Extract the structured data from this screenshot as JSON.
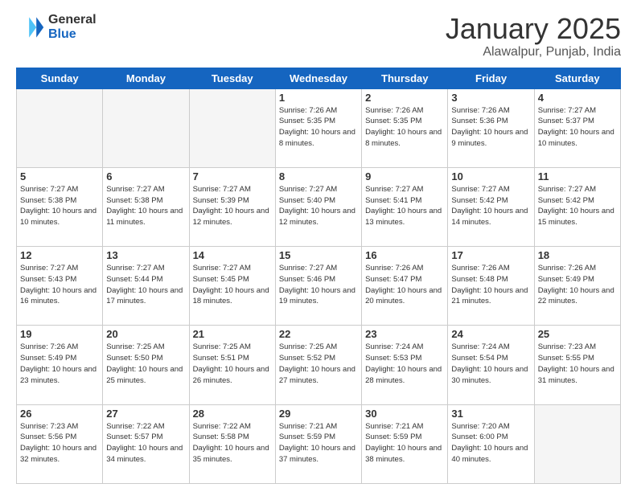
{
  "logo": {
    "line1": "General",
    "line2": "Blue"
  },
  "header": {
    "title": "January 2025",
    "subtitle": "Alawalpur, Punjab, India"
  },
  "weekdays": [
    "Sunday",
    "Monday",
    "Tuesday",
    "Wednesday",
    "Thursday",
    "Friday",
    "Saturday"
  ],
  "weeks": [
    [
      {
        "day": "",
        "detail": ""
      },
      {
        "day": "",
        "detail": ""
      },
      {
        "day": "",
        "detail": ""
      },
      {
        "day": "1",
        "detail": "Sunrise: 7:26 AM\nSunset: 5:35 PM\nDaylight: 10 hours\nand 8 minutes."
      },
      {
        "day": "2",
        "detail": "Sunrise: 7:26 AM\nSunset: 5:35 PM\nDaylight: 10 hours\nand 8 minutes."
      },
      {
        "day": "3",
        "detail": "Sunrise: 7:26 AM\nSunset: 5:36 PM\nDaylight: 10 hours\nand 9 minutes."
      },
      {
        "day": "4",
        "detail": "Sunrise: 7:27 AM\nSunset: 5:37 PM\nDaylight: 10 hours\nand 10 minutes."
      }
    ],
    [
      {
        "day": "5",
        "detail": "Sunrise: 7:27 AM\nSunset: 5:38 PM\nDaylight: 10 hours\nand 10 minutes."
      },
      {
        "day": "6",
        "detail": "Sunrise: 7:27 AM\nSunset: 5:38 PM\nDaylight: 10 hours\nand 11 minutes."
      },
      {
        "day": "7",
        "detail": "Sunrise: 7:27 AM\nSunset: 5:39 PM\nDaylight: 10 hours\nand 12 minutes."
      },
      {
        "day": "8",
        "detail": "Sunrise: 7:27 AM\nSunset: 5:40 PM\nDaylight: 10 hours\nand 12 minutes."
      },
      {
        "day": "9",
        "detail": "Sunrise: 7:27 AM\nSunset: 5:41 PM\nDaylight: 10 hours\nand 13 minutes."
      },
      {
        "day": "10",
        "detail": "Sunrise: 7:27 AM\nSunset: 5:42 PM\nDaylight: 10 hours\nand 14 minutes."
      },
      {
        "day": "11",
        "detail": "Sunrise: 7:27 AM\nSunset: 5:42 PM\nDaylight: 10 hours\nand 15 minutes."
      }
    ],
    [
      {
        "day": "12",
        "detail": "Sunrise: 7:27 AM\nSunset: 5:43 PM\nDaylight: 10 hours\nand 16 minutes."
      },
      {
        "day": "13",
        "detail": "Sunrise: 7:27 AM\nSunset: 5:44 PM\nDaylight: 10 hours\nand 17 minutes."
      },
      {
        "day": "14",
        "detail": "Sunrise: 7:27 AM\nSunset: 5:45 PM\nDaylight: 10 hours\nand 18 minutes."
      },
      {
        "day": "15",
        "detail": "Sunrise: 7:27 AM\nSunset: 5:46 PM\nDaylight: 10 hours\nand 19 minutes."
      },
      {
        "day": "16",
        "detail": "Sunrise: 7:26 AM\nSunset: 5:47 PM\nDaylight: 10 hours\nand 20 minutes."
      },
      {
        "day": "17",
        "detail": "Sunrise: 7:26 AM\nSunset: 5:48 PM\nDaylight: 10 hours\nand 21 minutes."
      },
      {
        "day": "18",
        "detail": "Sunrise: 7:26 AM\nSunset: 5:49 PM\nDaylight: 10 hours\nand 22 minutes."
      }
    ],
    [
      {
        "day": "19",
        "detail": "Sunrise: 7:26 AM\nSunset: 5:49 PM\nDaylight: 10 hours\nand 23 minutes."
      },
      {
        "day": "20",
        "detail": "Sunrise: 7:25 AM\nSunset: 5:50 PM\nDaylight: 10 hours\nand 25 minutes."
      },
      {
        "day": "21",
        "detail": "Sunrise: 7:25 AM\nSunset: 5:51 PM\nDaylight: 10 hours\nand 26 minutes."
      },
      {
        "day": "22",
        "detail": "Sunrise: 7:25 AM\nSunset: 5:52 PM\nDaylight: 10 hours\nand 27 minutes."
      },
      {
        "day": "23",
        "detail": "Sunrise: 7:24 AM\nSunset: 5:53 PM\nDaylight: 10 hours\nand 28 minutes."
      },
      {
        "day": "24",
        "detail": "Sunrise: 7:24 AM\nSunset: 5:54 PM\nDaylight: 10 hours\nand 30 minutes."
      },
      {
        "day": "25",
        "detail": "Sunrise: 7:23 AM\nSunset: 5:55 PM\nDaylight: 10 hours\nand 31 minutes."
      }
    ],
    [
      {
        "day": "26",
        "detail": "Sunrise: 7:23 AM\nSunset: 5:56 PM\nDaylight: 10 hours\nand 32 minutes."
      },
      {
        "day": "27",
        "detail": "Sunrise: 7:22 AM\nSunset: 5:57 PM\nDaylight: 10 hours\nand 34 minutes."
      },
      {
        "day": "28",
        "detail": "Sunrise: 7:22 AM\nSunset: 5:58 PM\nDaylight: 10 hours\nand 35 minutes."
      },
      {
        "day": "29",
        "detail": "Sunrise: 7:21 AM\nSunset: 5:59 PM\nDaylight: 10 hours\nand 37 minutes."
      },
      {
        "day": "30",
        "detail": "Sunrise: 7:21 AM\nSunset: 5:59 PM\nDaylight: 10 hours\nand 38 minutes."
      },
      {
        "day": "31",
        "detail": "Sunrise: 7:20 AM\nSunset: 6:00 PM\nDaylight: 10 hours\nand 40 minutes."
      },
      {
        "day": "",
        "detail": ""
      }
    ]
  ]
}
